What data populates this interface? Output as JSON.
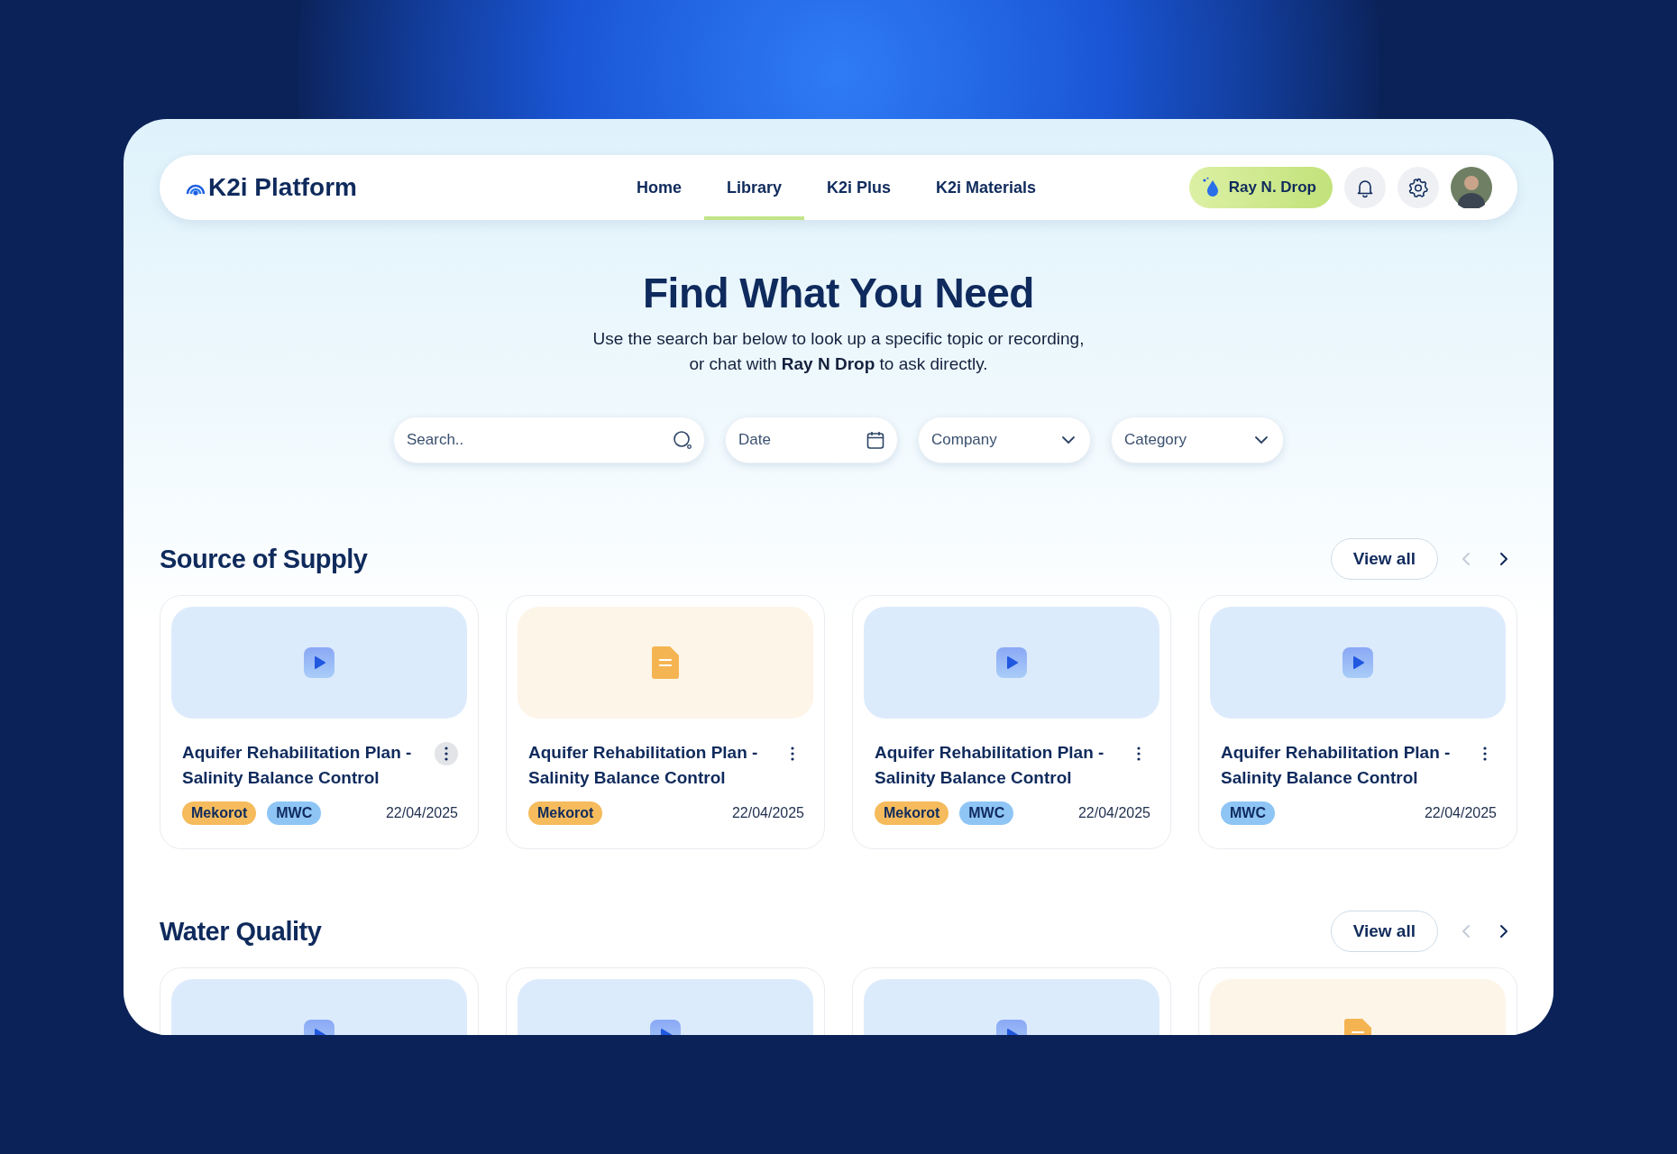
{
  "nav": {
    "logo": "K2i Platform",
    "links": [
      {
        "label": "Home",
        "selected": false
      },
      {
        "label": "Library",
        "selected": true
      },
      {
        "label": "K2i Plus",
        "selected": false
      },
      {
        "label": "K2i Materials",
        "selected": false
      }
    ],
    "user": {
      "name": "Ray N. Drop"
    }
  },
  "hero": {
    "title": "Find What You Need",
    "subtitle": [
      "Use the search bar below to look up a specific topic or recording,",
      "or chat with **Ray N Drop** to ask directly."
    ]
  },
  "filters": [
    {
      "kind": "search",
      "placeholder": "Search.."
    },
    {
      "kind": "date",
      "placeholder": "Date"
    },
    {
      "kind": "select",
      "placeholder": "Company"
    },
    {
      "kind": "select",
      "placeholder": "Category"
    }
  ],
  "sections": [
    {
      "title": "Source of Supply",
      "view_all": "View all",
      "prev_disabled": true,
      "cards": [
        {
          "kind": "video",
          "title": "Aquifer Rehabilitation Plan - Salinity Balance Control",
          "menu_hovered": true,
          "tags": [
            {
              "label": "Mekorot",
              "color": "#f5bb5c"
            },
            {
              "label": "MWC",
              "color": "#8ec5f5"
            }
          ],
          "date": "22/04/2025"
        },
        {
          "kind": "document",
          "title": "Aquifer Rehabilitation Plan - Salinity Balance Control",
          "menu_hovered": false,
          "tags": [
            {
              "label": "Mekorot",
              "color": "#f5bb5c"
            }
          ],
          "date": "22/04/2025"
        },
        {
          "kind": "video",
          "title": "Aquifer Rehabilitation Plan - Salinity Balance Control",
          "menu_hovered": false,
          "tags": [
            {
              "label": "Mekorot",
              "color": "#f5bb5c"
            },
            {
              "label": "MWC",
              "color": "#8ec5f5"
            }
          ],
          "date": "22/04/2025"
        },
        {
          "kind": "video",
          "title": "Aquifer Rehabilitation Plan - Salinity Balance Control",
          "menu_hovered": false,
          "tags": [
            {
              "label": "MWC",
              "color": "#8ec5f5"
            }
          ],
          "date": "22/04/2025"
        }
      ]
    },
    {
      "title": "Water Quality",
      "view_all": "View all",
      "prev_disabled": true,
      "cards": [
        {
          "kind": "video"
        },
        {
          "kind": "video"
        },
        {
          "kind": "video"
        },
        {
          "kind": "document"
        }
      ]
    }
  ]
}
